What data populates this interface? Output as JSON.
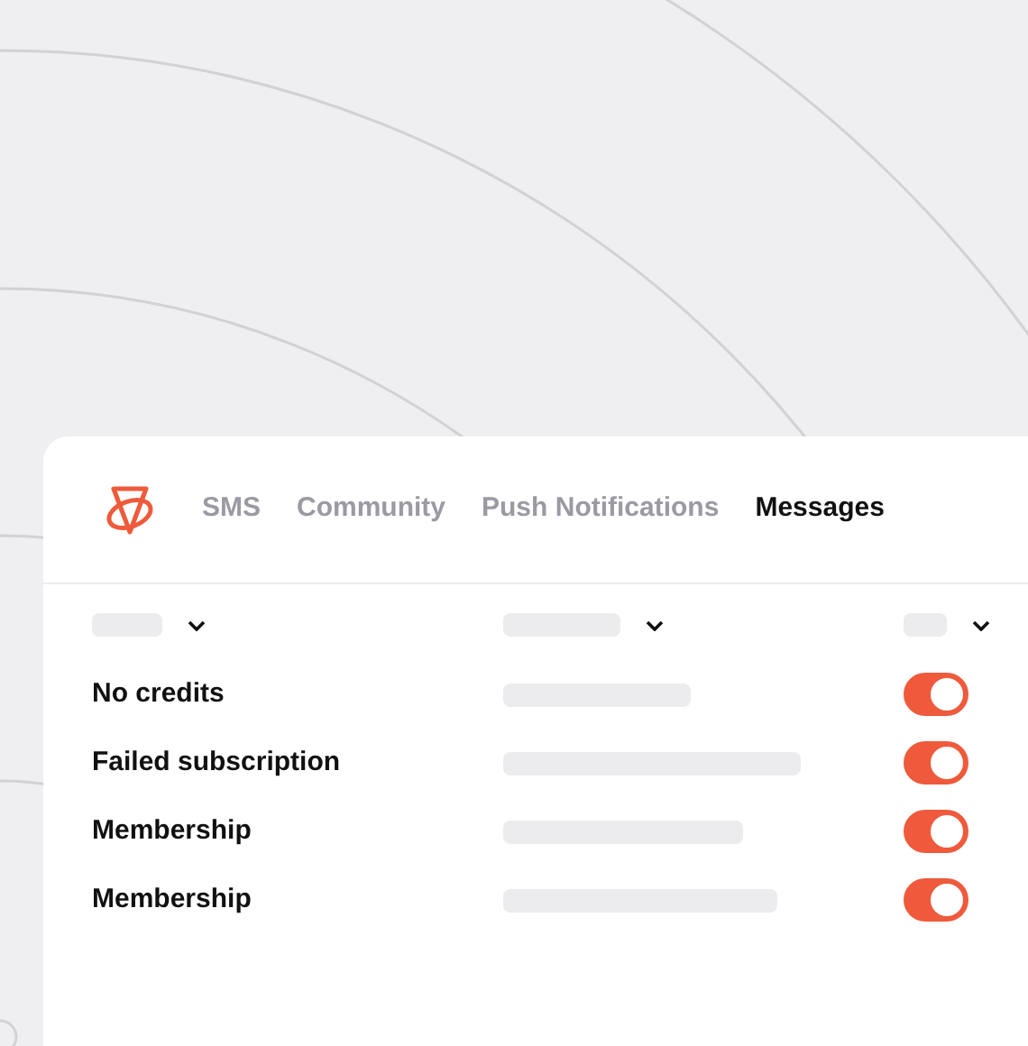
{
  "tabs": [
    {
      "label": "SMS",
      "selected": false
    },
    {
      "label": "Community",
      "selected": false
    },
    {
      "label": "Push Notifications",
      "selected": false
    },
    {
      "label": "Messages",
      "selected": true
    }
  ],
  "rows": [
    {
      "label": "No credits",
      "on": true
    },
    {
      "label": "Failed subscription",
      "on": true
    },
    {
      "label": "Membership",
      "on": true
    },
    {
      "label": "Membership",
      "on": true
    }
  ]
}
